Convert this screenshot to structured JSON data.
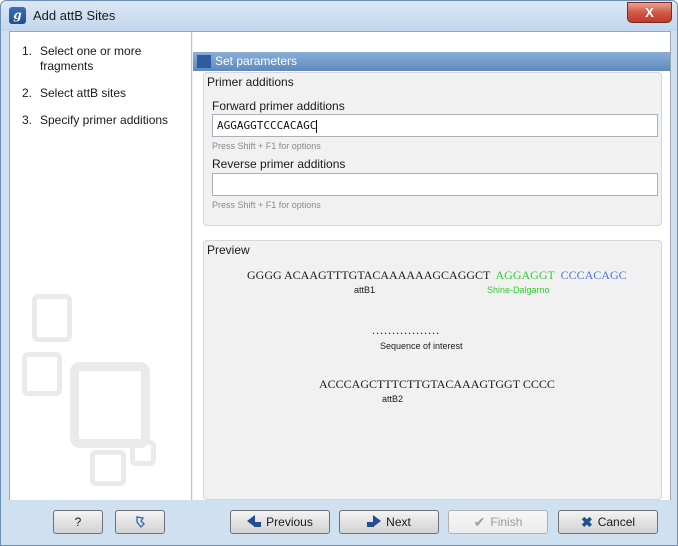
{
  "window": {
    "title": "Add attB Sites",
    "app_icon_letter": "g",
    "close_glyph": "X"
  },
  "steps": [
    {
      "num": "1.",
      "label": "Select one or more fragments"
    },
    {
      "num": "2.",
      "label": "Select attB sites"
    },
    {
      "num": "3.",
      "label": "Specify primer additions"
    }
  ],
  "panel": {
    "header": "Set parameters"
  },
  "primer_additions": {
    "title": "Primer additions",
    "forward_label": "Forward primer additions",
    "forward_value": "AGGAGGTCCCACAGC",
    "forward_hint": "Press Shift + F1 for options",
    "reverse_label": "Reverse primer additions",
    "reverse_value": "",
    "reverse_hint": "Press Shift + F1 for options"
  },
  "preview": {
    "title": "Preview",
    "line1_main": "GGGG ACAAGTTTGTACAAAAAAGCAGGCT",
    "line1_green": "AGGAGGT",
    "line1_blue": "CCCACAGC",
    "attb1": "attB1",
    "shine": "Shine-Dalgarno",
    "dots": ".................",
    "interest": "Sequence of interest",
    "line3": "ACCCAGCTTTCTTGTACAAAGTGGT CCCC",
    "attb2": "attB2"
  },
  "buttons": {
    "help": "?",
    "previous": "Previous",
    "next": "Next",
    "finish": "Finish",
    "cancel": "Cancel"
  }
}
